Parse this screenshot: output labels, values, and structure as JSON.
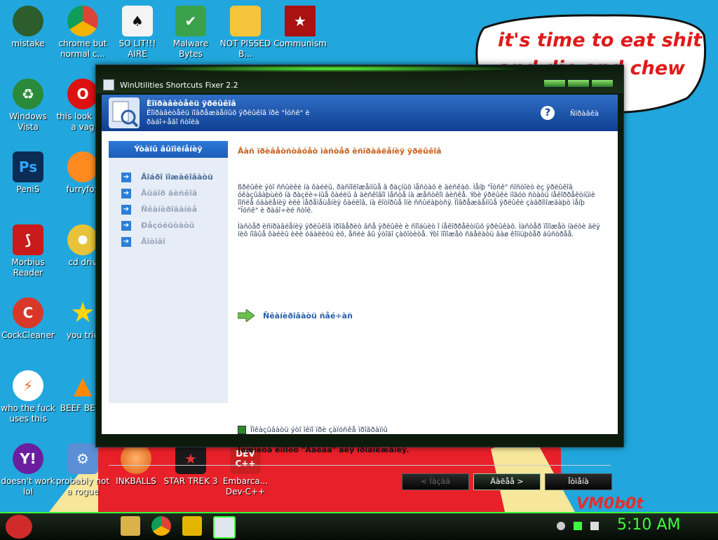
{
  "desktop": {
    "icons": [
      {
        "label": "mistake"
      },
      {
        "label": "chrome but normal c..."
      },
      {
        "label": "SO LIT!!! AIRE"
      },
      {
        "label": "Malware Bytes"
      },
      {
        "label": "NOT PISSED B..."
      },
      {
        "label": "Communism"
      },
      {
        "label": "Windows Vista"
      },
      {
        "label": "this look like a vag"
      },
      {
        "label": "PeniS"
      },
      {
        "label": "furryfox"
      },
      {
        "label": "Morbius Reader"
      },
      {
        "label": "cd driv"
      },
      {
        "label": "CockCleaner"
      },
      {
        "label": "you trie"
      },
      {
        "label": "who the fuck uses this"
      },
      {
        "label": "BEEF BEEF"
      },
      {
        "label": "doesn't work lol"
      },
      {
        "label": "probably not a rogue"
      },
      {
        "label": "INKBALLS"
      },
      {
        "label": "STAR TREK 3"
      },
      {
        "label": "Embarca... Dev-C++"
      }
    ],
    "bubble_line1": "it's time to eat shit",
    "bubble_line2": "and die and chew",
    "corner_text": "VM0b0t",
    "icon_dev_line1": "DEV",
    "icon_dev_line2": "C++",
    "icon_ps": "Ps"
  },
  "window": {
    "title": "WinUtilities Shortcuts Fixer 2.2",
    "banner_title": "Èîïðàâèòåëü ÿðëûêîâ",
    "banner_subtitle": "Ëîïðàâèòåëü ïîâðåæäåííûõ ÿðëûêîâ ïðè \"Íóñê\" è ðàáî÷åãî ñòîëà",
    "help_label": "Ñïðàâêà",
    "sidebar_header": "Ýòàïû âûïîëíåíèÿ",
    "sidebar_items": [
      {
        "label": "Äîáðî ïîæàëîâàòü"
      },
      {
        "label": "Âûáîð äèñêîâ"
      },
      {
        "label": "Ñêàíèðîâàíèå"
      },
      {
        "label": "Ðåçóëüòàòû"
      },
      {
        "label": "Ãîòîâî"
      }
    ],
    "main_title": "Âàñ ïðèâåòñòâóåò ìàñòåð èñïðàâëåíèÿ ÿðëûêîâ",
    "paragraph1": "ßðëûêè ýòî ññûëêè íà ôàéëû, ðàñïîëîæåííûå â ðàçíûõ ìåñòàõ è äèñêàõ. Ìåíþ \"Ïóñê\" ñîñòîèò èç ÿðëûêîâ óêàçûâàþùèõ íà ðàçëè÷íûå ôàéëû â äèñêîâîì ìåñòå íà æåñòêîì äèñêå. Ýòè ÿðëûêè ìîãóò ñòàòü íåêîððåêòíûìè ïîñëå óäàëåíèÿ èëè ïåðåìåùåíèÿ ôàéëîâ, íà êîòîðûå îíè ññûëàþòñÿ. Ïîâðåæäåííûå ÿðëûêè çàãðîìîæäàþò ìåíþ \"Ïóñê\" è ðàáî÷èé ñòîë.",
    "paragraph2": "Ìàñòåð èñïðàâëåíèÿ ÿðëûêîâ ïðîâåðèò âñå ÿðëûêè è ñîîáùèò î íåêîððåêòíûõ ÿðëûêàõ. Ìàñòåð ïîìîæåò íàéòè äëÿ íèõ íîâûå ôàéëû èëè óäàëèòü èõ, åñëè âû ýòîãî çàõîòèòå. Ýòî ïîìîæåò ñäåëàòü âàø êîìïüþòåð áûñòðåå.",
    "restore_label": "Ñêàíèðîâàòü ñåé÷àñ",
    "checkbox_label": "Ïîêàçûâàòü ýòî îêíî ïðè çàïóñêå ïðîãðàììû",
    "note": "Íàæìèòå êíîïêó \"Äàëåå\" äëÿ ïðîäîëæåíèÿ.",
    "buttons": {
      "back": "< Íàçàä",
      "next": "Äàëåå >",
      "cancel": "Îòìåíà"
    }
  },
  "taskbar": {
    "clock": "5:10 AM"
  }
}
